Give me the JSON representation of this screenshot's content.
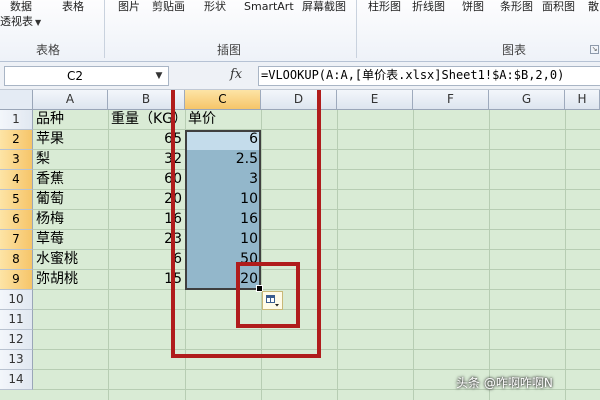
{
  "ribbon": {
    "buttons": {
      "pivot_table_top": "数据",
      "table": "表格",
      "picture": "图片",
      "clipart": "剪贴画",
      "shapes": "形状",
      "smartart": "SmartArt",
      "screenshot": "屏幕截图",
      "column_chart": "柱形图",
      "line_chart": "折线图",
      "pie_chart": "饼图",
      "bar_chart": "条形图",
      "area_chart": "面积图",
      "more": "散"
    },
    "pivot_bottom": "透视表",
    "groups": {
      "tables": "表格",
      "illustrations": "插图",
      "charts": "图表"
    }
  },
  "formula_bar": {
    "name_box": "C2",
    "fx": "fx",
    "formula": "=VLOOKUP(A:A,[单价表.xlsx]Sheet1!$A:$B,2,0)"
  },
  "grid": {
    "columns": [
      "A",
      "B",
      "C",
      "D",
      "E",
      "F",
      "G",
      "H"
    ],
    "rows": [
      "1",
      "2",
      "3",
      "4",
      "5",
      "6",
      "7",
      "8",
      "9",
      "10",
      "11",
      "12",
      "13",
      "14"
    ],
    "header_row": {
      "a": "品种",
      "b": "重量（KG）",
      "c": "单价"
    },
    "data": [
      {
        "a": "苹果",
        "b": "65",
        "c": "6"
      },
      {
        "a": "梨",
        "b": "32",
        "c": "2.5"
      },
      {
        "a": "香蕉",
        "b": "60",
        "c": "3"
      },
      {
        "a": "葡萄",
        "b": "20",
        "c": "10"
      },
      {
        "a": "杨梅",
        "b": "16",
        "c": "16"
      },
      {
        "a": "草莓",
        "b": "23",
        "c": "10"
      },
      {
        "a": "水蜜桃",
        "b": "6",
        "c": "50"
      },
      {
        "a": "弥胡桃",
        "b": "15",
        "c": "20"
      }
    ]
  },
  "colors": {
    "highlight_red": "#b01c1c",
    "selection": "#93b7cb",
    "sheet_green": "#d9ebd5"
  },
  "watermark": "头条 @咋啊咋啊N"
}
